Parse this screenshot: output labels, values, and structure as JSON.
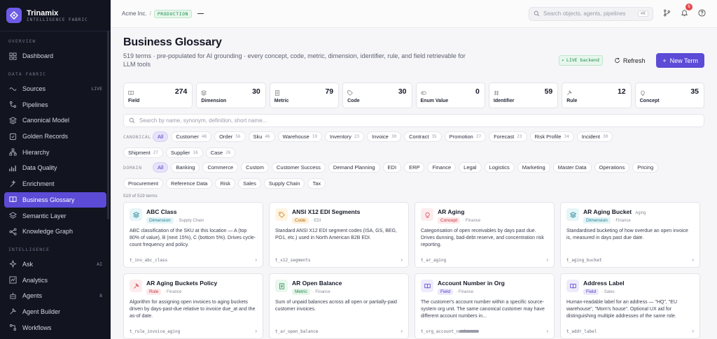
{
  "brand": {
    "name": "Trinamix",
    "subtitle": "INTELLIGENCE FABRIC"
  },
  "sidebar": {
    "sections": [
      {
        "label": "OVERVIEW"
      },
      {
        "label": "DATA FABRIC"
      },
      {
        "label": "INTELLIGENCE"
      }
    ],
    "overview": [
      {
        "label": "Dashboard",
        "icon": "dashboard-icon"
      }
    ],
    "fabric": [
      {
        "label": "Sources",
        "badge": "LIVE",
        "icon": "sources-icon"
      },
      {
        "label": "Pipelines",
        "icon": "pipelines-icon"
      },
      {
        "label": "Canonical Model",
        "icon": "canonical-icon"
      },
      {
        "label": "Golden Records",
        "icon": "golden-icon"
      },
      {
        "label": "Hierarchy",
        "icon": "hierarchy-icon"
      },
      {
        "label": "Data Quality",
        "icon": "quality-icon"
      },
      {
        "label": "Enrichment",
        "icon": "enrichment-icon"
      },
      {
        "label": "Business Glossary",
        "icon": "book-icon"
      },
      {
        "label": "Semantic Layer",
        "icon": "layer-icon"
      },
      {
        "label": "Knowledge Graph",
        "icon": "graph-icon"
      }
    ],
    "intelligence": [
      {
        "label": "Ask",
        "badge": "AI",
        "icon": "ask-icon"
      },
      {
        "label": "Analytics",
        "icon": "analytics-icon"
      },
      {
        "label": "Agents",
        "badge": "8",
        "icon": "agents-icon"
      },
      {
        "label": "Agent Builder",
        "icon": "builder-icon"
      },
      {
        "label": "Workflows",
        "icon": "workflows-icon"
      }
    ]
  },
  "topbar": {
    "org": "Acme Inc.",
    "slash": "/",
    "env": "PRODUCTION",
    "search_placeholder": "Search objects, agents, pipelines",
    "kbd": "⌘K",
    "notif_count": "6"
  },
  "header": {
    "title": "Business Glossary",
    "description": "519 terms · pre-populated for AI grounding · every concept, code, metric, dimension, identifier, rule, and field retrievable for LLM tools",
    "live": "LIVE backend",
    "refresh": "Refresh",
    "new_term": "New Term"
  },
  "stats": [
    {
      "label": "Field",
      "value": "274"
    },
    {
      "label": "Dimension",
      "value": "30"
    },
    {
      "label": "Metric",
      "value": "79"
    },
    {
      "label": "Code",
      "value": "30"
    },
    {
      "label": "Enum Value",
      "value": "0"
    },
    {
      "label": "Identifier",
      "value": "59"
    },
    {
      "label": "Rule",
      "value": "12"
    },
    {
      "label": "Concept",
      "value": "35"
    }
  ],
  "search_placeholder": "Search by name, synonym, definition, short name...",
  "canonical": {
    "label": "CANONICAL",
    "chips": [
      {
        "label": "All",
        "count": ""
      },
      {
        "label": "Customer",
        "count": "48"
      },
      {
        "label": "Order",
        "count": "56"
      },
      {
        "label": "Sku",
        "count": "46"
      },
      {
        "label": "Warehouse",
        "count": "19"
      },
      {
        "label": "Inventory",
        "count": "23"
      },
      {
        "label": "Invoice",
        "count": "30"
      },
      {
        "label": "Contract",
        "count": "35"
      },
      {
        "label": "Promotion",
        "count": "27"
      },
      {
        "label": "Forecast",
        "count": "23"
      },
      {
        "label": "Risk Profile",
        "count": "34"
      },
      {
        "label": "Incident",
        "count": "30"
      },
      {
        "label": "Shipment",
        "count": "27"
      },
      {
        "label": "Supplier",
        "count": "16"
      },
      {
        "label": "Case",
        "count": "26"
      }
    ]
  },
  "domain": {
    "label": "DOMAIN",
    "chips": [
      "All",
      "Banking",
      "Commerce",
      "Custom",
      "Customer Success",
      "Demand Planning",
      "EDI",
      "ERP",
      "Finance",
      "Legal",
      "Logistics",
      "Marketing",
      "Master Data",
      "Operations",
      "Pricing",
      "Procurement",
      "Reference Data",
      "Risk",
      "Sales",
      "Supply Chain",
      "Tax"
    ]
  },
  "count_text": "519 of 519 terms",
  "cards": [
    {
      "name": "ABC Class",
      "side": "",
      "type": "Dimension",
      "domain": "Supply Chain",
      "desc": "ABC classification of the SKU at this location — A (top 80% of value), B (next 15%), C (bottom 5%). Drives cycle-count frequency and policy.",
      "key": "t_inv_abc_class",
      "icon": "layers-icon"
    },
    {
      "name": "ANSI X12 EDI Segments",
      "side": "",
      "type": "Code",
      "domain": "EDI",
      "desc": "Standard ANSI X12 EDI segment codes (ISA, GS, BEG, PO1, etc.) used in North American B2B EDI.",
      "key": "t_x12_segments",
      "icon": "tag-icon"
    },
    {
      "name": "AR Aging",
      "side": "",
      "type": "Concept",
      "domain": "Finance",
      "desc": "Categorisation of open receivables by days past due. Drives dunning, bad-debt reserve, and concentration risk reporting.",
      "key": "t_ar_aging",
      "icon": "bulb-icon"
    },
    {
      "name": "AR Aging Bucket",
      "side": "Aging",
      "type": "Dimension",
      "domain": "Finance",
      "desc": "Standardised bucketing of how overdue an open invoice is, measured in days past due date.",
      "key": "t_aging_bucket",
      "icon": "layers-icon"
    },
    {
      "name": "AR Aging Buckets Policy",
      "side": "",
      "type": "Rule",
      "domain": "Finance",
      "desc": "Algorithm for assigning open invoices to aging buckets driven by days-past-due relative to invoice due_at and the as-of date.",
      "key": "t_rule_invoice_aging",
      "icon": "gavel-icon"
    },
    {
      "name": "AR Open Balance",
      "side": "",
      "type": "Metric",
      "domain": "Finance",
      "desc": "Sum of unpaid balances across all open or partially-paid customer invoices.",
      "key": "t_ar_open_balance",
      "icon": "doc-icon"
    },
    {
      "name": "Account Number in Org",
      "side": "",
      "type": "Field",
      "domain": "Finance",
      "desc": "The customer's account number within a specific source-system org unit. The same canonical customer may have different account numbers in...",
      "key": "t_org_account_number",
      "icon": "book-icon"
    },
    {
      "name": "Address Label",
      "side": "",
      "type": "Field",
      "domain": "Sales",
      "desc": "Human-readable label for an address — \"HQ\", \"EU warehouse\", \"Mom's house\". Optional UX aid for distinguishing multiple addresses of the same role.",
      "key": "t_addr_label",
      "icon": "book-icon"
    }
  ],
  "colors": {
    "accent": "#5b4bd6",
    "sidebar": "#12141f"
  }
}
